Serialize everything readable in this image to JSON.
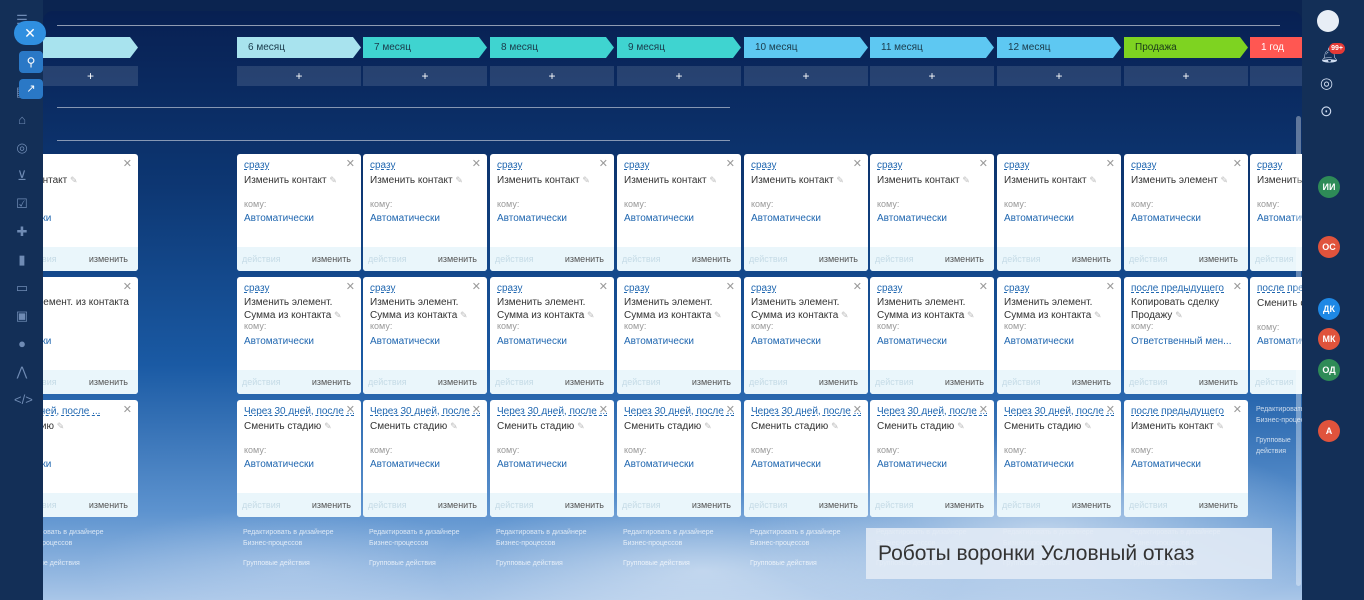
{
  "nav": {
    "close_icon": "close-icon",
    "link_icon": "link-icon",
    "external_icon": "external-link-icon"
  },
  "stages": [
    {
      "label": "",
      "color": "#a8e3ee",
      "text": "#1a3a4a"
    },
    {
      "label": "6 месяц",
      "color": "#a8e3ee",
      "text": "#1a3a4a"
    },
    {
      "label": "7 месяц",
      "color": "#3fd4d0",
      "text": "#1a3a4a"
    },
    {
      "label": "8 месяц",
      "color": "#3fd4d0",
      "text": "#1a3a4a"
    },
    {
      "label": "9 месяц",
      "color": "#3fd4d0",
      "text": "#1a3a4a"
    },
    {
      "label": "10 месяц",
      "color": "#5ec8f2",
      "text": "#1a3a4a"
    },
    {
      "label": "11 месяц",
      "color": "#5ec8f2",
      "text": "#1a3a4a"
    },
    {
      "label": "12 месяц",
      "color": "#5ec8f2",
      "text": "#1a3a4a"
    },
    {
      "label": "Продажа",
      "color": "#7ed321",
      "text": "#1a3a1a"
    },
    {
      "label": "1 год",
      "color": "#ff5752",
      "text": "#ffffff"
    }
  ],
  "add_label": "+",
  "card_labels": {
    "to": "кому:",
    "actions": "действия",
    "edit": "изменить"
  },
  "col_footer": {
    "edit_designer": "Редактировать в дизайнере Бизнес-процессов",
    "group_actions": "Групповые действия"
  },
  "rows": [
    [
      {
        "when": "",
        "title": "ть контакт",
        "resp": "ически"
      },
      {
        "when": "сразу",
        "title": "Изменить контакт",
        "resp": "Автоматически"
      },
      {
        "when": "сразу",
        "title": "Изменить контакт",
        "resp": "Автоматически"
      },
      {
        "when": "сразу",
        "title": "Изменить контакт",
        "resp": "Автоматически"
      },
      {
        "when": "сразу",
        "title": "Изменить контакт",
        "resp": "Автоматически"
      },
      {
        "when": "сразу",
        "title": "Изменить контакт",
        "resp": "Автоматически"
      },
      {
        "when": "сразу",
        "title": "Изменить контакт",
        "resp": "Автоматически"
      },
      {
        "when": "сразу",
        "title": "Изменить контакт",
        "resp": "Автоматически"
      },
      {
        "when": "сразу",
        "title": "Изменить элемент",
        "resp": "Автоматически"
      },
      {
        "when": "сразу",
        "title": "Изменить контакт",
        "resp": "Автоматически"
      }
    ],
    [
      {
        "when": "",
        "title": "ть элемент. из контакта",
        "resp": "ически"
      },
      {
        "when": "сразу",
        "title": "Изменить элемент. Сумма из контакта",
        "resp": "Автоматически"
      },
      {
        "when": "сразу",
        "title": "Изменить элемент. Сумма из контакта",
        "resp": "Автоматически"
      },
      {
        "when": "сразу",
        "title": "Изменить элемент. Сумма из контакта",
        "resp": "Автоматически"
      },
      {
        "when": "сразу",
        "title": "Изменить элемент. Сумма из контакта",
        "resp": "Автоматически"
      },
      {
        "when": "сразу",
        "title": "Изменить элемент. Сумма из контакта",
        "resp": "Автоматически"
      },
      {
        "when": "сразу",
        "title": "Изменить элемент. Сумма из контакта",
        "resp": "Автоматически"
      },
      {
        "when": "сразу",
        "title": "Изменить элемент. Сумма из контакта",
        "resp": "Автоматически"
      },
      {
        "when": "после предыдущего",
        "title": "Копировать сделку Продажу",
        "resp": "Ответственный мен..."
      },
      {
        "when": "после предыдущего",
        "title": "Сменить стадию",
        "resp": "Автоматически"
      }
    ],
    [
      {
        "when": "30 дней, после ...",
        "title": "стадию",
        "resp": "ически"
      },
      {
        "when": "Через 30 дней, после ...",
        "title": "Сменить стадию",
        "resp": "Автоматически"
      },
      {
        "when": "Через 30 дней, после ...",
        "title": "Сменить стадию",
        "resp": "Автоматически"
      },
      {
        "when": "Через 30 дней, после ...",
        "title": "Сменить стадию",
        "resp": "Автоматически"
      },
      {
        "when": "Через 30 дней, после ...",
        "title": "Сменить стадию",
        "resp": "Автоматически"
      },
      {
        "when": "Через 30 дней, после ...",
        "title": "Сменить стадию",
        "resp": "Автоматически"
      },
      {
        "when": "Через 30 дней, после ...",
        "title": "Сменить стадию",
        "resp": "Автоматически"
      },
      {
        "when": "Через 30 дней, после ...",
        "title": "Сменить стадию",
        "resp": "Автоматически"
      },
      {
        "when": "после предыдущего",
        "title": "Изменить контакт",
        "resp": "Автоматически"
      }
    ]
  ],
  "right_rail": [
    {
      "label": "99+",
      "color": "#e53935"
    },
    {
      "label": "ИИ",
      "color": "#2e8b57"
    },
    {
      "label": "ОС",
      "color": "#e0533c"
    },
    {
      "label": "ДК",
      "color": "#1e88e5"
    },
    {
      "label": "МК",
      "color": "#e0533c"
    },
    {
      "label": "ОД",
      "color": "#2e8b57"
    },
    {
      "label": "А",
      "color": "#e0533c"
    }
  ],
  "caption": "Роботы воронки Условный отказ"
}
